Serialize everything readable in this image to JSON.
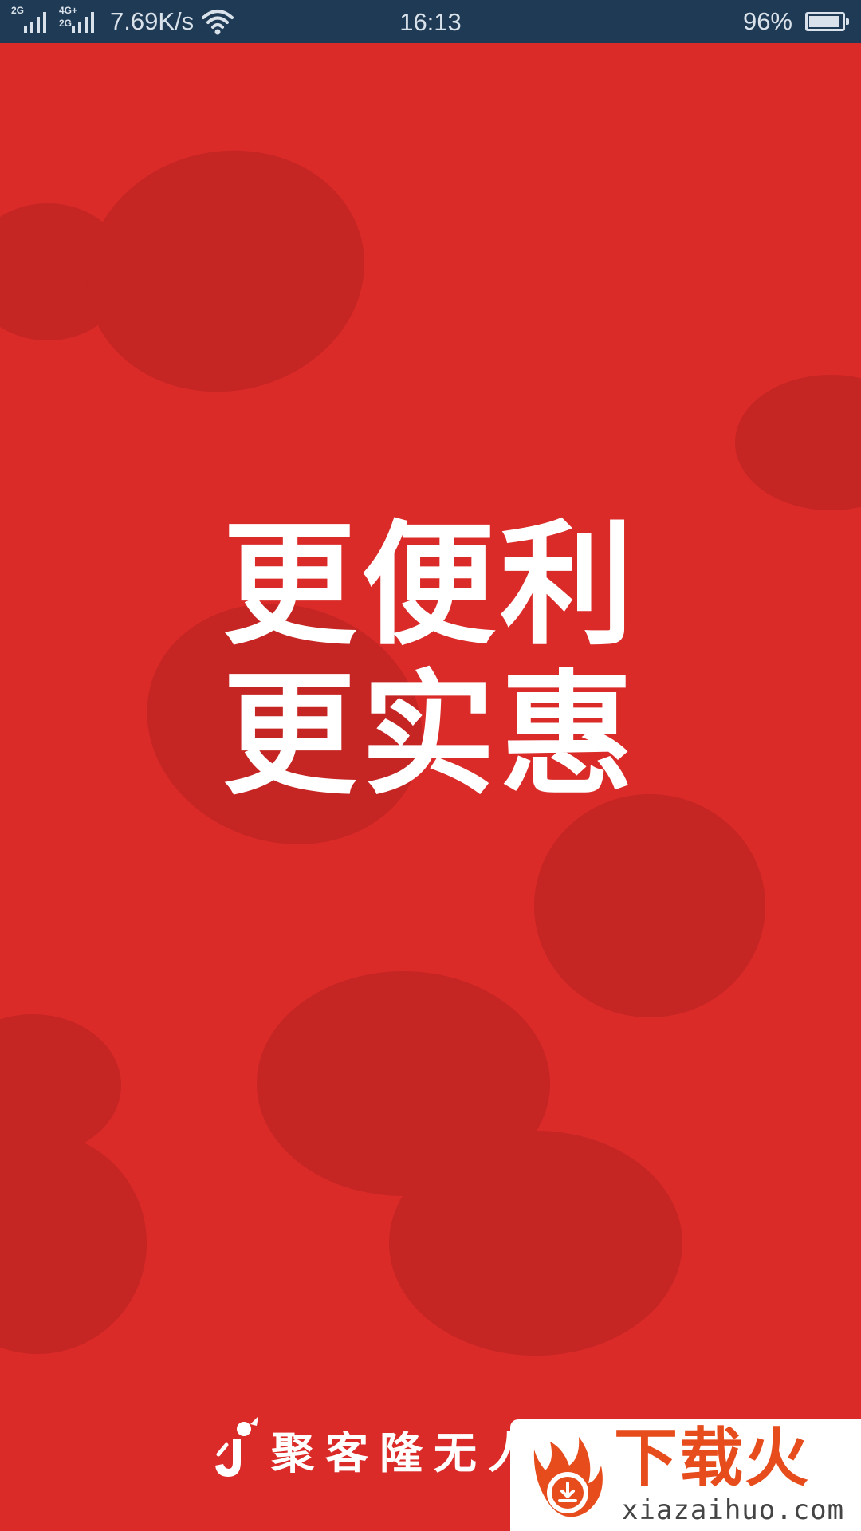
{
  "status_bar": {
    "sim1_tag": "2G",
    "sim2_tag_top": "4G+",
    "sim2_tag_bottom": "2G",
    "speed": "7.69K/s",
    "time": "16:13",
    "battery_percent": "96%",
    "battery_level": 0.96,
    "icons": [
      "signal-icon",
      "signal-icon",
      "wifi-icon",
      "battery-icon"
    ]
  },
  "splash": {
    "line1": "更便利",
    "line2": "更实惠",
    "background_color": "#da2b29",
    "blob_color": "#c52523"
  },
  "brand": {
    "logo_icon": "brand-logo-icon",
    "name": "聚客隆无人超市"
  },
  "watermark": {
    "title": "下载火",
    "url": "xiazaihuo.com",
    "accent_color": "#e64c1c"
  }
}
